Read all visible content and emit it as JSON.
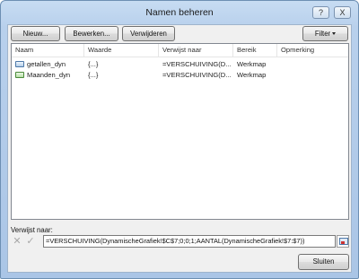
{
  "window": {
    "title": "Namen beheren",
    "help_label": "?",
    "close_label": "X"
  },
  "toolbar": {
    "new_label": "Nieuw...",
    "edit_label": "Bewerken...",
    "delete_label": "Verwijderen",
    "filter_label": "Filter"
  },
  "table": {
    "columns": [
      "Naam",
      "Waarde",
      "Verwijst naar",
      "Bereik",
      "Opmerking"
    ],
    "rows": [
      {
        "name": "getallen_dyn",
        "value": "{...}",
        "refers_to": "=VERSCHUIVING(D...",
        "scope": "Werkmap",
        "comment": "",
        "icon": "range-name-icon"
      },
      {
        "name": "Maanden_dyn",
        "value": "{...}",
        "refers_to": "=VERSCHUIVING(D...",
        "scope": "Werkmap",
        "comment": "",
        "icon": "range-name-icon"
      }
    ]
  },
  "refers_to": {
    "label": "Verwijst naar:",
    "value": "=VERSCHUIVING(DynamischeGrafiek!$C$7;0;0;1;AANTAL(DynamischeGrafiek!$7:$7))",
    "cancel_icon": "x-icon",
    "confirm_icon": "check-icon"
  },
  "footer": {
    "close_label": "Sluiten"
  }
}
